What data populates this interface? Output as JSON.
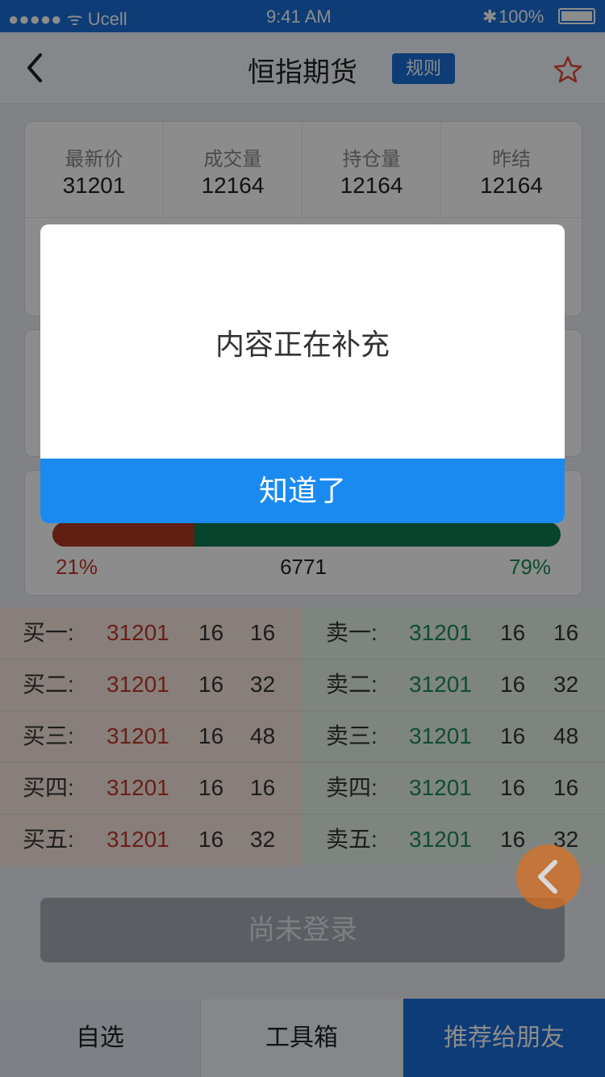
{
  "status_bar": {
    "carrier": "●●●●● ᯤ Ucell",
    "time": "9:41 AM",
    "battery": "100%"
  },
  "nav": {
    "title": "恒指期货",
    "rule_button": "规则",
    "back_icon": "back-icon",
    "star_icon": "star-icon"
  },
  "stats": [
    {
      "label": "最新价",
      "value": "31201"
    },
    {
      "label": "成交量",
      "value": "12164"
    },
    {
      "label": "持仓量",
      "value": "12164"
    },
    {
      "label": "昨结",
      "value": "12164"
    }
  ],
  "ratio": {
    "buy_percent": "21%",
    "total": "6771",
    "sell_percent": "79%",
    "buy_fraction": 0.28
  },
  "order_book": {
    "buy": [
      {
        "label": "买一:",
        "price": "31201",
        "qty": "16",
        "cum": "16"
      },
      {
        "label": "买二:",
        "price": "31201",
        "qty": "16",
        "cum": "32"
      },
      {
        "label": "买三:",
        "price": "31201",
        "qty": "16",
        "cum": "48"
      },
      {
        "label": "买四:",
        "price": "31201",
        "qty": "16",
        "cum": "16"
      },
      {
        "label": "买五:",
        "price": "31201",
        "qty": "16",
        "cum": "32"
      }
    ],
    "sell": [
      {
        "label": "卖一:",
        "price": "31201",
        "qty": "16",
        "cum": "16"
      },
      {
        "label": "卖二:",
        "price": "31201",
        "qty": "16",
        "cum": "32"
      },
      {
        "label": "卖三:",
        "price": "31201",
        "qty": "16",
        "cum": "48"
      },
      {
        "label": "卖四:",
        "price": "31201",
        "qty": "16",
        "cum": "16"
      },
      {
        "label": "卖五:",
        "price": "31201",
        "qty": "16",
        "cum": "32"
      }
    ]
  },
  "login_button": "尚未登录",
  "tabs": [
    {
      "label": "自选"
    },
    {
      "label": "工具箱"
    },
    {
      "label": "推荐给朋友"
    }
  ],
  "modal": {
    "message": "内容正在补充",
    "confirm": "知道了"
  },
  "colors": {
    "brand_blue": "#1a6ed8",
    "modal_button": "#1a8af0",
    "buy_red": "#c2392b",
    "sell_green": "#1d8a5c",
    "float_button": "#e0701c"
  }
}
